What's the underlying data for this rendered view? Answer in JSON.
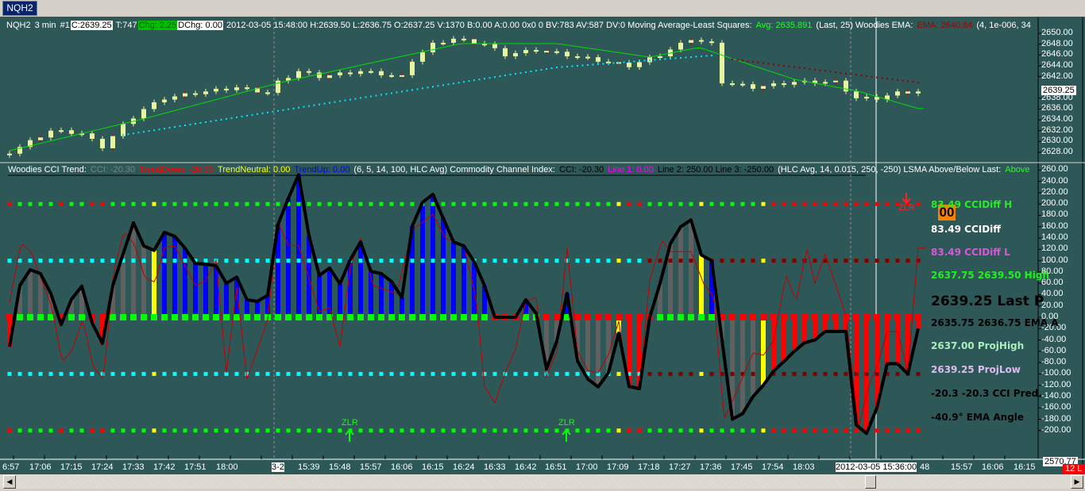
{
  "tab": {
    "label": "NQH2"
  },
  "header": {
    "symbol": "NQH2",
    "interval": "3 min",
    "num": "#1",
    "close": "C:2639.25",
    "ticks": "T:747",
    "chg": "Chg: 2.25",
    "dchg": "DChg: 0.00",
    "info": "2012-03-05 15:48:00 H:2639.50 L:2636.75 O:2637.25 V:1370 B:0.00 A:0.00 0x0 0 BV:783 AV:587 DV:0 Moving Average-Least Squares:",
    "avg": "Avg: 2635.891",
    "avg_params": "(Last, 25)  Woodies EMA:",
    "ema": "EMA: 2640.84",
    "ema_params": "(4, 1e-006, 34"
  },
  "cci_header": {
    "title": "Woodies CCI Trend:",
    "cci": "CCI: -20.30",
    "down": "TrendDown: -20.30",
    "neutral": "TrendNeutral: 0.00",
    "up": "TrendUp: 0.00",
    "params": "(6, 5, 14, 100, HLC Avg)  Commodity Channel Index:",
    "cci2": "CCI: -20.30",
    "line1": "Line 1: 0.00",
    "line23": "Line 2: 250.00  Line 3: -250.00",
    "params2": "(HLC Avg, 14, 0.015, 250, -250)  LSMA Above/Below Last:",
    "lsma": "Above"
  },
  "price_axis": [
    "2650.00",
    "2648.00",
    "2646.00",
    "2644.00",
    "2642.00",
    "2638.00",
    "2636.00",
    "2634.00",
    "2632.00",
    "2630.00",
    "2628.00"
  ],
  "price_last": "2639.25",
  "cci_axis": [
    "260.00",
    "240.00",
    "220.00",
    "200.00",
    "180.00",
    "160.00",
    "140.00",
    "120.00",
    "100.00",
    "80.00",
    "60.00",
    "40.00",
    "20.00",
    "0.00",
    "-20.00",
    "-40.00",
    "-60.00",
    "-80.00",
    "-100.00",
    "-120.00",
    "-140.00",
    "-160.00",
    "-180.00",
    "-200.00"
  ],
  "bottom_value": "2570.77",
  "bottom_badge": "12 L",
  "right_labels": [
    {
      "text": "83.49 CCIDiff H",
      "color": "#22ee22"
    },
    {
      "text": "83.49 CCIDiff",
      "color": "#ffffff"
    },
    {
      "text": "83.49 CCIDiff L",
      "color": "#dd55dd"
    },
    {
      "text": "2637.75 2639.50 High",
      "color": "#22ee22"
    },
    {
      "text": "2639.25 Last P",
      "color": "#000000"
    },
    {
      "text": "2635.75 2636.75 EMA A",
      "color": "#000000"
    },
    {
      "text": "2637.00 ProjHigh",
      "color": "#aaeebb"
    },
    {
      "text": "2639.25 ProjLow",
      "color": "#ddbbee"
    },
    {
      "text": "-20.3   -20.3 CCI Pred.",
      "color": "#000000"
    },
    {
      "text": "-40.9° EMA Angle",
      "color": "#000000"
    }
  ],
  "orange_badge": "00",
  "zlr_label": "ZLR",
  "time_axis": [
    "6:57",
    "17:06",
    "17:15",
    "17:24",
    "17:33",
    "17:42",
    "17:51",
    "18:00",
    "3-2",
    "15:39",
    "15:48",
    "15:57",
    "16:06",
    "16:15",
    "16:24",
    "16:33",
    "16:42",
    "16:51",
    "17:00",
    "17:09",
    "17:18",
    "17:27",
    "17:36",
    "17:45",
    "17:54",
    "18:03",
    "2012-03-05  15:36:00",
    "48",
    "15:57",
    "16:06",
    "16:15"
  ],
  "chart_data": {
    "type": "line",
    "price_range": [
      2626,
      2651
    ],
    "close_keypoints": [
      [
        0,
        2628
      ],
      [
        4,
        2632
      ],
      [
        7,
        2631.5
      ],
      [
        9,
        2629
      ],
      [
        11,
        2633
      ],
      [
        13,
        2636
      ],
      [
        15,
        2638
      ],
      [
        18,
        2639
      ],
      [
        22,
        2640
      ],
      [
        25,
        2639
      ],
      [
        26,
        2641
      ],
      [
        28,
        2643
      ],
      [
        30,
        2642
      ],
      [
        34,
        2643
      ],
      [
        38,
        2642
      ],
      [
        39,
        2645
      ],
      [
        41,
        2648
      ],
      [
        43,
        2649
      ],
      [
        46,
        2648
      ],
      [
        48,
        2646
      ],
      [
        51,
        2647
      ],
      [
        54,
        2646
      ],
      [
        57,
        2645
      ],
      [
        60,
        2644
      ],
      [
        63,
        2646
      ],
      [
        66,
        2649
      ],
      [
        68,
        2648
      ],
      [
        69,
        2641
      ],
      [
        72,
        2640
      ],
      [
        76,
        2641
      ],
      [
        80,
        2641
      ],
      [
        82,
        2638
      ],
      [
        84,
        2638
      ],
      [
        86,
        2639
      ],
      [
        88,
        2639.25
      ]
    ],
    "lsma_keypoints": [
      [
        0,
        2628.3
      ],
      [
        13,
        2634.2
      ],
      [
        26,
        2640.8
      ],
      [
        43.7,
        2648.1
      ],
      [
        53,
        2648.1
      ],
      [
        62,
        2645.6
      ],
      [
        66.8,
        2647.4
      ],
      [
        71.4,
        2644.4
      ],
      [
        76,
        2641.5
      ],
      [
        82.2,
        2639.3
      ],
      [
        88,
        2636.1
      ]
    ],
    "ema_dots_up": [
      [
        11,
        2631.2
      ],
      [
        53,
        2643.7
      ],
      [
        68,
        2645.9
      ]
    ],
    "ema_dots_down": [
      [
        70,
        2645.2
      ],
      [
        88,
        2640.9
      ]
    ],
    "cci_range": [
      -220,
      260
    ],
    "cci_values": [
      -52,
      56,
      84,
      77,
      42,
      -13,
      32,
      55,
      -10,
      -46,
      56,
      112,
      167,
      126,
      118,
      150,
      143,
      122,
      95,
      94,
      91,
      60,
      71,
      31,
      28,
      39,
      164,
      210,
      252,
      144,
      74,
      87,
      59,
      102,
      133,
      81,
      77,
      63,
      35,
      161,
      203,
      217,
      175,
      133,
      126,
      98,
      56,
      0,
      0,
      0,
      31,
      7,
      -91,
      -42,
      42,
      -77,
      -109,
      -123,
      -98,
      -28,
      -122,
      -126,
      0,
      60,
      130,
      160,
      172,
      110,
      100,
      -40,
      -180,
      -170,
      -140,
      -120,
      -95,
      -78,
      -60,
      -45,
      -40,
      -25,
      -25,
      -25,
      -190,
      -205,
      -160,
      -82,
      -82,
      -100,
      -20
    ],
    "bar_trend": "rggggrggrrggggybbbbbbbbbbbbbbbbbbbbbbbbbbbbbbbbnnnbnggbggggyrrnggggybggggyrrrrrrrrrrrrrrr",
    "tcci_keypoints": [
      [
        0,
        25
      ],
      [
        1.1,
        131
      ],
      [
        2.1,
        115
      ],
      [
        4.1,
        18
      ],
      [
        5.1,
        -80
      ],
      [
        6.1,
        -56
      ],
      [
        7.1,
        -3
      ],
      [
        8.1,
        -88
      ],
      [
        9.1,
        -109
      ],
      [
        10.1,
        84
      ],
      [
        11.1,
        151
      ],
      [
        12.1,
        129
      ],
      [
        13.1,
        70
      ],
      [
        14.1,
        62
      ],
      [
        15,
        123
      ],
      [
        16,
        126
      ],
      [
        18,
        56
      ],
      [
        19,
        64
      ],
      [
        20,
        101
      ],
      [
        21,
        -98
      ],
      [
        22,
        53
      ],
      [
        23,
        -109
      ],
      [
        25,
        -4
      ],
      [
        26,
        168
      ],
      [
        27,
        127
      ],
      [
        28,
        127
      ],
      [
        30,
        10
      ],
      [
        31,
        17
      ],
      [
        32,
        -52
      ],
      [
        33,
        88
      ],
      [
        34,
        140
      ],
      [
        35.2,
        56
      ],
      [
        37.5,
        42
      ],
      [
        39,
        154
      ],
      [
        41,
        182
      ],
      [
        42.2,
        140
      ],
      [
        44,
        126
      ],
      [
        45.2,
        32
      ],
      [
        46,
        -122
      ],
      [
        47,
        -151
      ],
      [
        48,
        -98
      ],
      [
        49,
        -56
      ],
      [
        50,
        28
      ],
      [
        51,
        35
      ],
      [
        52,
        -105
      ],
      [
        53,
        -60
      ],
      [
        54,
        123
      ],
      [
        55,
        -60
      ],
      [
        56,
        -94
      ],
      [
        57,
        -98
      ],
      [
        58,
        -66
      ],
      [
        59,
        -7
      ],
      [
        60,
        -126
      ],
      [
        61,
        -122
      ],
      [
        62,
        66
      ],
      [
        63.2,
        136
      ],
      [
        64,
        116
      ],
      [
        66,
        116
      ],
      [
        67.3,
        56
      ],
      [
        68.2,
        38
      ],
      [
        69.2,
        -179
      ],
      [
        70.2,
        -140
      ],
      [
        72,
        -63
      ],
      [
        73,
        -67
      ],
      [
        74,
        -42
      ],
      [
        75.2,
        74
      ],
      [
        76.2,
        28
      ],
      [
        77.2,
        123
      ],
      [
        78,
        60
      ],
      [
        79,
        112
      ],
      [
        81,
        3
      ],
      [
        82.2,
        -196
      ],
      [
        83.3,
        -116
      ],
      [
        84,
        -88
      ],
      [
        85,
        -25
      ],
      [
        86,
        -25
      ],
      [
        87,
        -98
      ],
      [
        88,
        123
      ]
    ],
    "levels": [
      200,
      100,
      0,
      -100,
      -200
    ],
    "zlr_up_bars": [
      33,
      54
    ],
    "zlr_down_bars": [
      87
    ],
    "colors": {
      "up": "#0000ff",
      "down": "#ff0000",
      "neutral": "#ffff00",
      "cci": "#606060",
      "line": "#000000",
      "tcci": "#c00000",
      "lsma": "#00dd00",
      "candle": "#e8f5a0"
    }
  }
}
